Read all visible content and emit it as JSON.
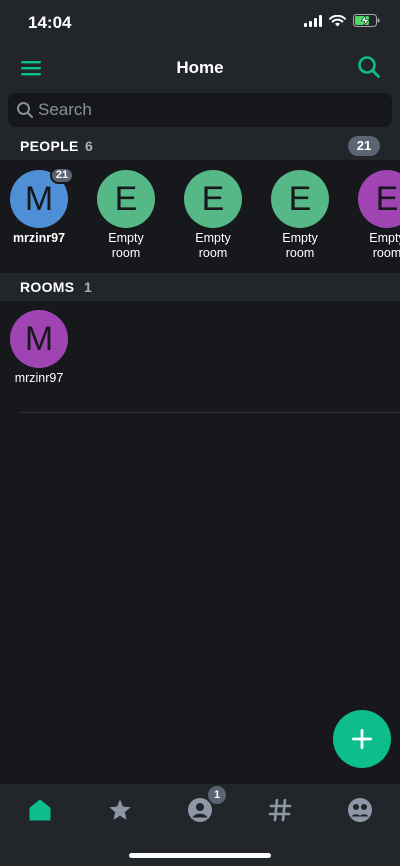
{
  "status_bar": {
    "time": "14:04"
  },
  "header": {
    "title": "Home"
  },
  "search": {
    "placeholder": "Search"
  },
  "people_section": {
    "title": "PEOPLE",
    "count": "6",
    "badge": "21",
    "items": [
      {
        "initial": "M",
        "label_line1": "mrzinr97",
        "label_line2": "",
        "badge": "21",
        "color": "#4f8fd6"
      },
      {
        "initial": "E",
        "label_line1": "Empty",
        "label_line2": "room",
        "badge": "",
        "color": "#57b887"
      },
      {
        "initial": "E",
        "label_line1": "Empty",
        "label_line2": "room",
        "badge": "",
        "color": "#57b887"
      },
      {
        "initial": "E",
        "label_line1": "Empty",
        "label_line2": "room",
        "badge": "",
        "color": "#57b887"
      },
      {
        "initial": "E",
        "label_line1": "Empty",
        "label_line2": "room",
        "badge": "",
        "color": "#a144b3"
      }
    ]
  },
  "rooms_section": {
    "title": "ROOMS",
    "count": "1",
    "items": [
      {
        "initial": "M",
        "label": "mrzinr97",
        "color": "#a144b3"
      }
    ]
  },
  "tab_bar": {
    "people_badge": "1",
    "accent_color": "#0dbd8b",
    "icon_color": "#8d97a5"
  }
}
